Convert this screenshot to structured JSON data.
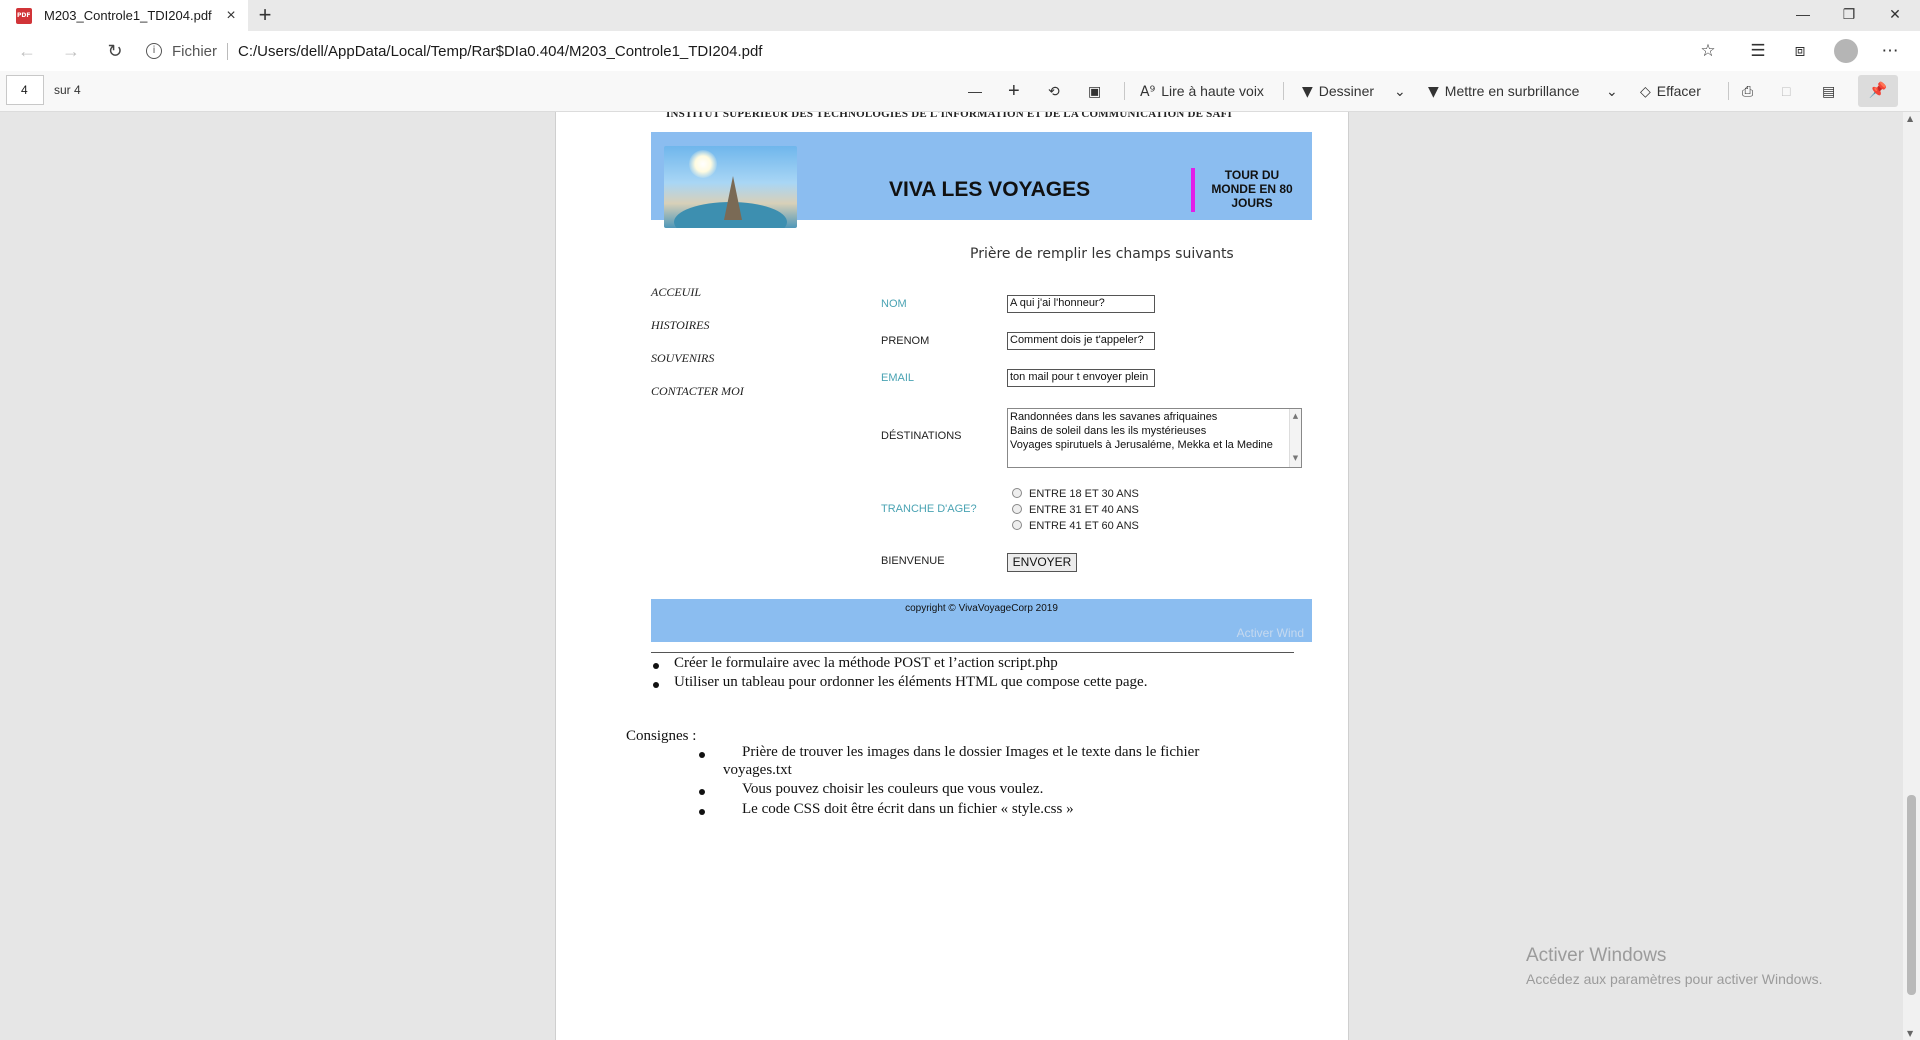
{
  "browser": {
    "tab_title": "M203_Controle1_TDI204.pdf",
    "tab_close": "×",
    "new_tab": "+",
    "window_controls": {
      "minimize": "—",
      "restore": "❐",
      "close": "✕"
    },
    "site_info_label": "Fichier",
    "url": "C:/Users/dell/AppData/Local/Temp/Rar$DIa0.404/M203_Controle1_TDI204.pdf",
    "icons": {
      "back": "back-arrow-icon",
      "forward": "forward-arrow-icon",
      "refresh": "refresh-icon",
      "favorite": "star-icon",
      "favorites_bar": "favorites-icon",
      "collections": "collections-icon",
      "profile": "profile-avatar",
      "more": "more-icon"
    }
  },
  "pdf_toolbar": {
    "page_number": "4",
    "page_of": "sur 4",
    "read_aloud": "Lire à haute voix",
    "draw": "Dessiner",
    "highlight": "Mettre en surbrillance",
    "erase": "Effacer"
  },
  "document": {
    "institut_header": "INSTITUT SUPERIEUR DES TECHNOLOGIES DE L'INFORMATION ET DE LA COMMUNICATION DE SAFI",
    "mockup": {
      "site_title": "VIVA LES VOYAGES",
      "tour_line1": "TOUR DU",
      "tour_line2": "MONDE EN 80",
      "tour_line3": "JOURS",
      "prompt": "Prière de remplir les champs suivants",
      "nav": [
        "ACCEUIL",
        "HISTOIRES",
        "SOUVENIRS",
        "CONTACTER MOI"
      ],
      "fields": {
        "nom_label": "NOM",
        "nom_value": "A qui j'ai l'honneur?",
        "prenom_label": "PRENOM",
        "prenom_value": "Comment dois je t'appeler?",
        "email_label": "EMAIL",
        "email_value": "ton mail pour t envoyer plein",
        "destinations_label": "DÉSTINATIONS",
        "destinations_options": [
          "Randonnées dans les savanes afriquaines",
          "Bains de soleil dans les ils mystérieuses",
          "Voyages spirutuels à Jerusaléme, Mekka et la Medine"
        ],
        "age_label": "TRANCHE D'AGE?",
        "age_options": [
          "ENTRE 18 ET 30 ANS",
          "ENTRE 31 ET 40 ANS",
          "ENTRE 41 ET 60 ANS"
        ],
        "bienvenue_label": "BIENVENUE",
        "submit": "ENVOYER"
      },
      "footer": "copyright © VivaVoyageCorp 2019",
      "faint_watermark": "Activer Wind"
    },
    "tasks": [
      "Créer le formulaire avec la méthode POST et l’action script.php",
      "Utiliser un tableau pour ordonner les éléments HTML que compose cette page."
    ],
    "consignes_title": "Consignes :",
    "consignes": [
      {
        "line1": "Prière de trouver les images dans le dossier Images et le texte dans le fichier",
        "line2": "voyages.txt"
      },
      {
        "line1": "Vous pouvez choisir les couleurs que vous voulez."
      },
      {
        "line1": "Le code CSS doit être écrit dans un fichier « style.css »"
      }
    ]
  },
  "windows_activation": {
    "title": "Activer Windows",
    "subtitle": "Accédez aux paramètres pour activer Windows."
  },
  "colors": {
    "mockup_blue": "#8bbdf0",
    "accent_magenta": "#e21ee8",
    "teal_label": "#4aa3b3"
  }
}
